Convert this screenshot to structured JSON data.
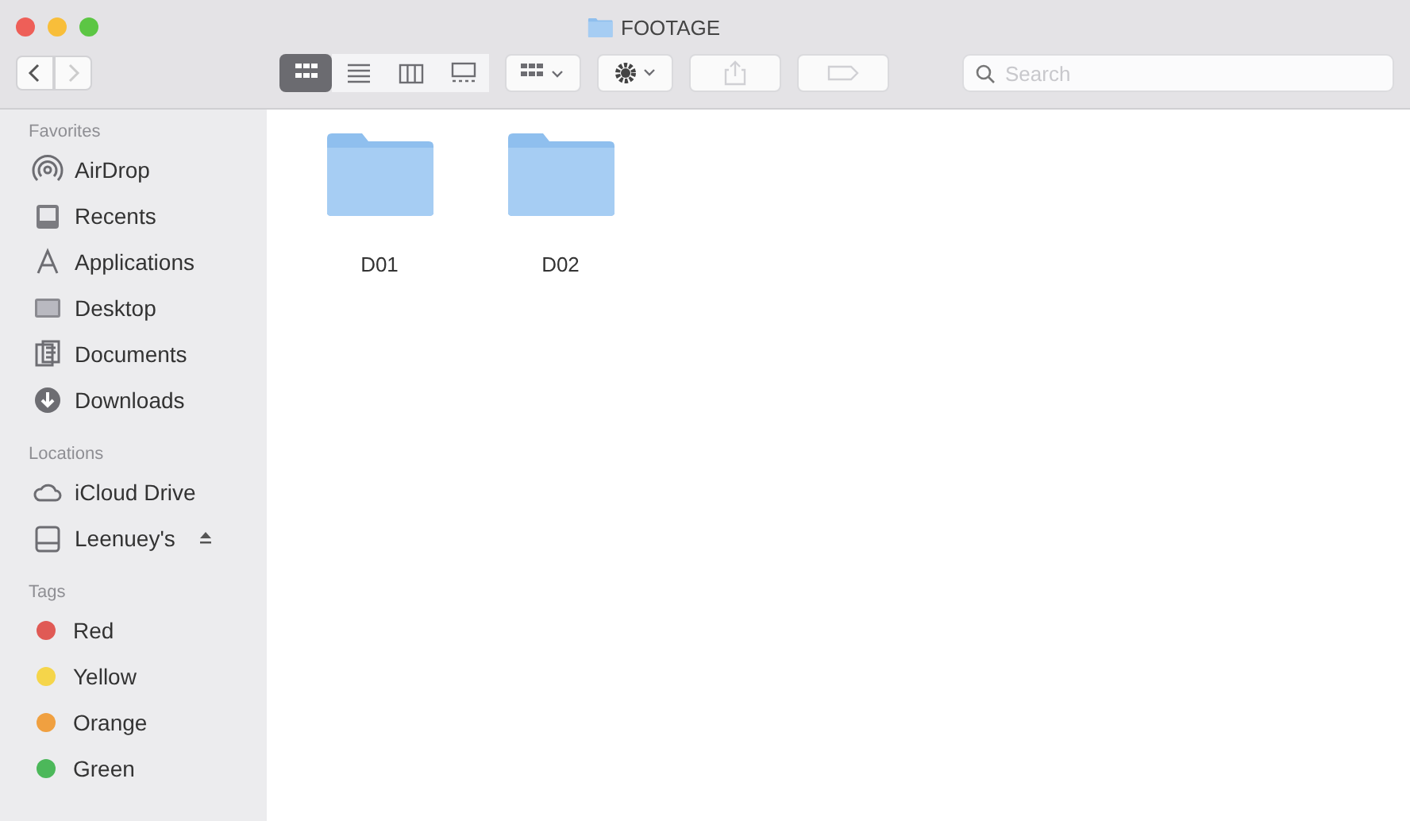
{
  "window": {
    "title": "FOOTAGE"
  },
  "toolbar": {
    "view_modes": [
      {
        "kind": "icons",
        "selected": true
      },
      {
        "kind": "list",
        "selected": false
      },
      {
        "kind": "columns",
        "selected": false
      },
      {
        "kind": "gallery",
        "selected": false
      }
    ],
    "search": {
      "placeholder": "Search"
    }
  },
  "sidebar": {
    "sections": [
      {
        "title": "Favorites",
        "items": [
          {
            "label": "AirDrop",
            "kind": "airdrop"
          },
          {
            "label": "Recents",
            "kind": "recents"
          },
          {
            "label": "Applications",
            "kind": "applications"
          },
          {
            "label": "Desktop",
            "kind": "desktop"
          },
          {
            "label": "Documents",
            "kind": "documents"
          },
          {
            "label": "Downloads",
            "kind": "downloads"
          }
        ]
      },
      {
        "title": "Locations",
        "items": [
          {
            "label": "iCloud Drive",
            "kind": "cloud"
          },
          {
            "label": "Leenuey's",
            "kind": "disk",
            "eject": true
          }
        ]
      },
      {
        "title": "Tags",
        "items": [
          {
            "label": "Red",
            "kind": "tag",
            "color": "#e05a55"
          },
          {
            "label": "Yellow",
            "kind": "tag",
            "color": "#f5d54a"
          },
          {
            "label": "Orange",
            "kind": "tag",
            "color": "#f0a040"
          },
          {
            "label": "Green",
            "kind": "tag",
            "color": "#4cb85a"
          }
        ]
      }
    ]
  },
  "files": [
    {
      "name": "D01"
    },
    {
      "name": "D02"
    }
  ]
}
